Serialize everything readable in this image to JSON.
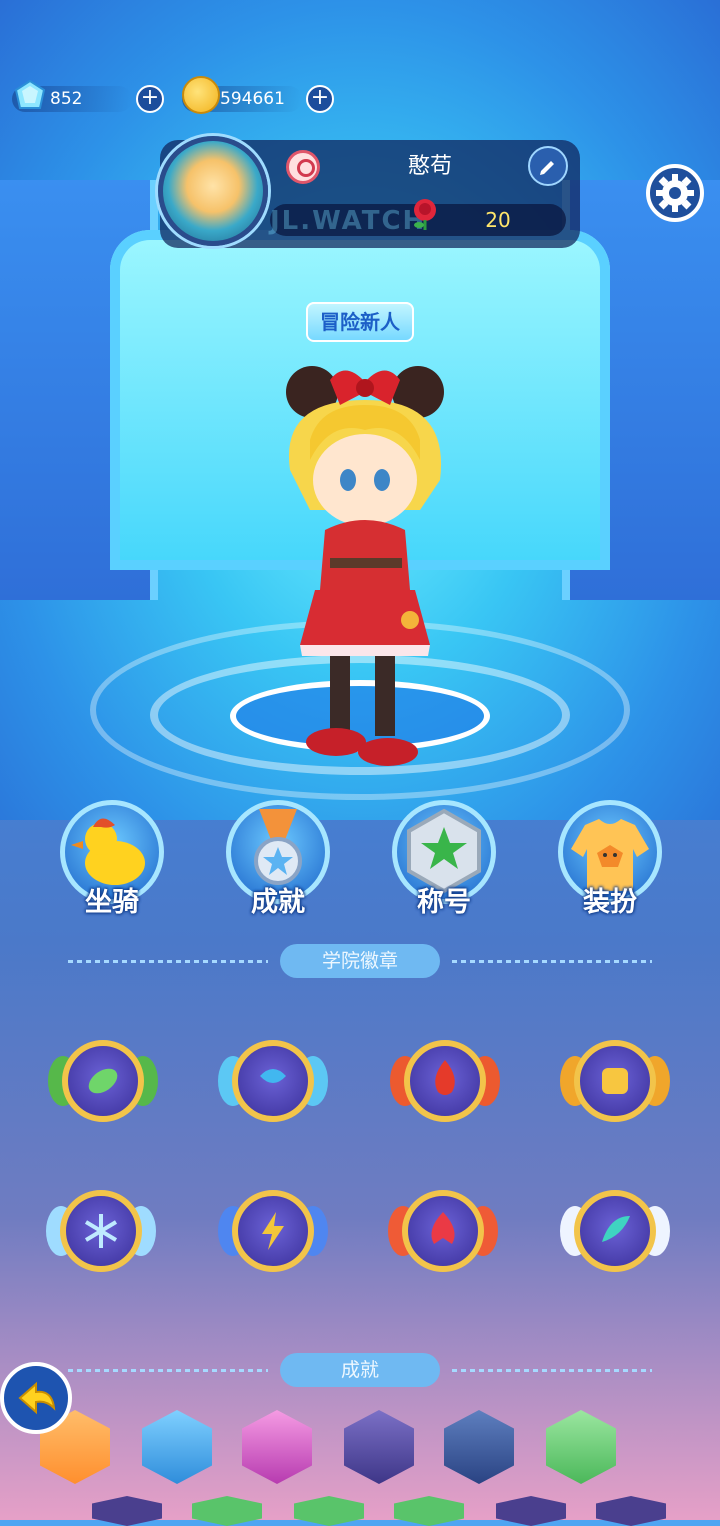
{
  "currency": {
    "gems": "852",
    "coins": "594661",
    "add_symbol": "+"
  },
  "profile": {
    "name": "憨苟",
    "roses": "20",
    "watermark": "JL.WATCH"
  },
  "title_tag": "冒险新人",
  "menu": [
    {
      "label": "坐骑",
      "icon": "duck-mount-icon"
    },
    {
      "label": "成就",
      "icon": "medal-icon"
    },
    {
      "label": "称号",
      "icon": "star-badge-icon"
    },
    {
      "label": "装扮",
      "icon": "fox-sweater-icon"
    }
  ],
  "sections": {
    "badges_title": "学院徽章",
    "achievements_title": "成就"
  },
  "badges": [
    {
      "icon": "leaf-badge-icon",
      "color": "#5cc35a"
    },
    {
      "icon": "water-badge-icon",
      "color": "#2fb4ee"
    },
    {
      "icon": "fire-badge-icon",
      "color": "#e3452d"
    },
    {
      "icon": "earth-badge-icon",
      "color": "#f2a529"
    },
    {
      "icon": "ice-badge-icon",
      "color": "#7fd5ff"
    },
    {
      "icon": "lightning-badge-icon",
      "color": "#f3c739"
    },
    {
      "icon": "flame-badge-icon",
      "color": "#e93b45"
    },
    {
      "icon": "wind-badge-icon",
      "color": "#3fd4c1"
    }
  ],
  "achievements": [
    {
      "color": "#ff9a3d"
    },
    {
      "color": "#4cb4f5"
    },
    {
      "color": "#e060c6"
    },
    {
      "color": "#5a4fa7"
    },
    {
      "color": "#3c5a9c"
    },
    {
      "color": "#6fd07a"
    }
  ],
  "back_symbol": "➜"
}
